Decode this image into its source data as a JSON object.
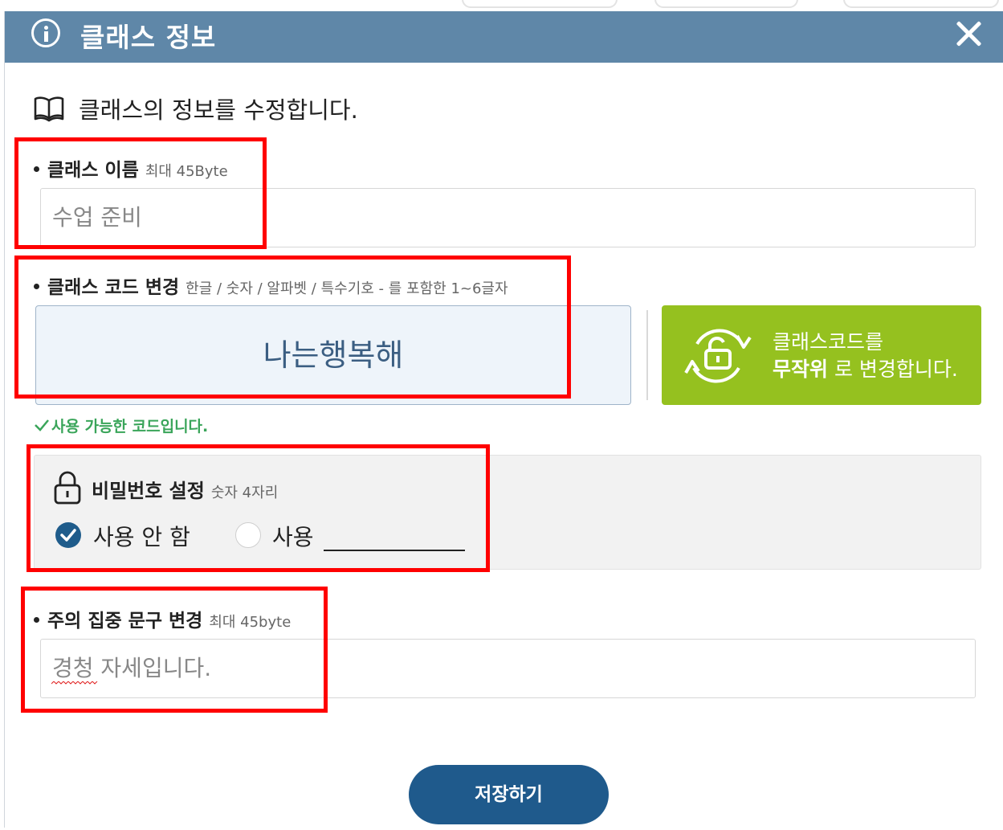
{
  "dialog": {
    "title": "클래스 정보",
    "subtitle": "클래스의 정보를 수정합니다."
  },
  "class_name": {
    "label": "클래스 이름",
    "hint": "최대 45Byte",
    "value": "수업 준비"
  },
  "class_code": {
    "label": "클래스 코드 변경",
    "hint": "한글 / 숫자 / 알파벳 / 특수기호 - 를 포함한 1~6글자",
    "value": "나는행복해",
    "status": "사용 가능한 코드입니다."
  },
  "random_button": {
    "line1": "클래스코드를",
    "line2_bold": "무작위",
    "line2_rest": " 로 변경합니다."
  },
  "password": {
    "label": "비밀번호 설정",
    "hint": "숫자 4자리",
    "option_off": "사용 안 함",
    "option_on": "사용",
    "selected": "사용 안 함"
  },
  "focus_phrase": {
    "label": "주의 집중 문구 변경",
    "hint": "최대 45byte",
    "value": "경청 자세입니다."
  },
  "save_label": "저장하기",
  "colors": {
    "titlebar": "#5f87a8",
    "random_button": "#95c11f",
    "save_button": "#1f5a8c",
    "status": "#3aa55a",
    "annotation": "#ff0000"
  },
  "icons": [
    "info-icon",
    "close-icon",
    "book-icon",
    "refresh-unlock-icon",
    "lock-icon",
    "check-icon"
  ]
}
